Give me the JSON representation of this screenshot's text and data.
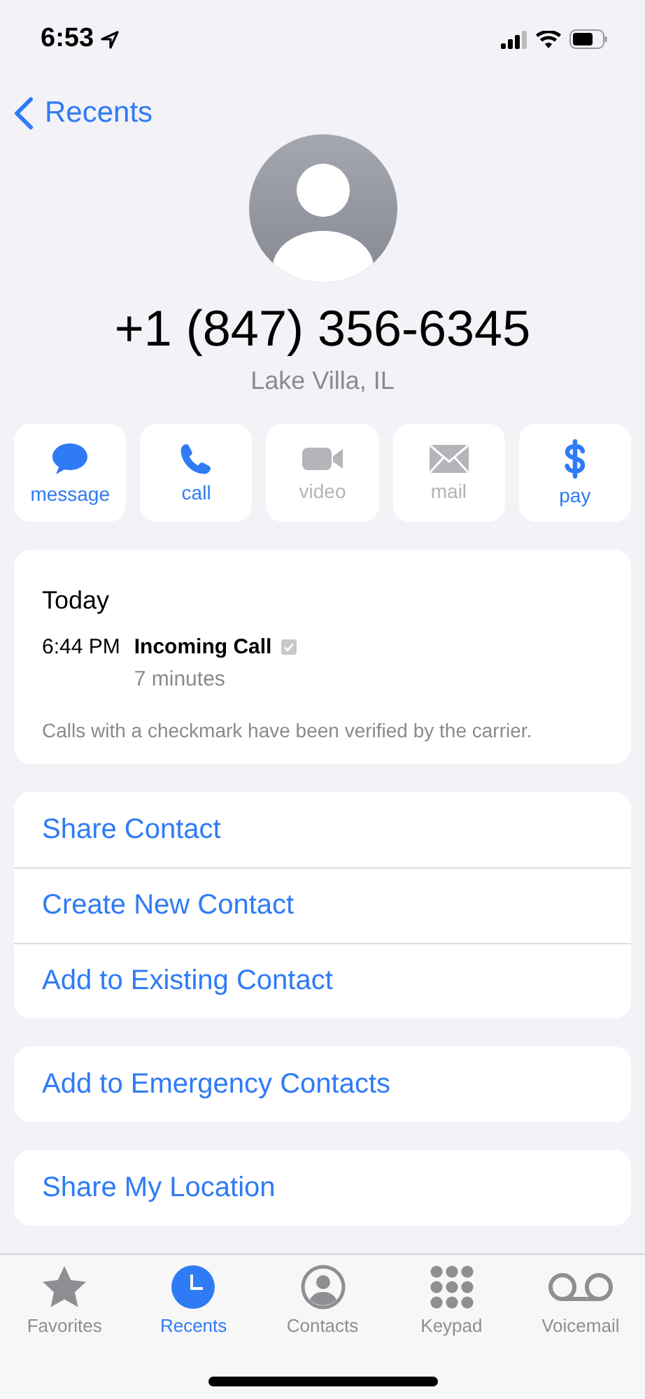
{
  "status_bar": {
    "time": "6:53"
  },
  "nav": {
    "back_label": "Recents"
  },
  "contact": {
    "number": "+1 (847) 356-6345",
    "location": "Lake Villa, IL"
  },
  "actions": [
    {
      "kind": "message",
      "label": "message",
      "disabled": false
    },
    {
      "kind": "call",
      "label": "call",
      "disabled": false
    },
    {
      "kind": "video",
      "label": "video",
      "disabled": true
    },
    {
      "kind": "mail",
      "label": "mail",
      "disabled": true
    },
    {
      "kind": "pay",
      "label": "pay",
      "disabled": false
    }
  ],
  "call_log": {
    "day": "Today",
    "entries": [
      {
        "time": "6:44 PM",
        "type": "Incoming Call",
        "verified": true,
        "duration": "7 minutes"
      }
    ],
    "note": "Calls with a checkmark have been verified by the carrier."
  },
  "option_groups": [
    [
      "Share Contact",
      "Create New Contact",
      "Add to Existing Contact"
    ],
    [
      "Add to Emergency Contacts"
    ],
    [
      "Share My Location"
    ]
  ],
  "tabs": [
    {
      "kind": "favorites",
      "label": "Favorites",
      "selected": false
    },
    {
      "kind": "recents",
      "label": "Recents",
      "selected": true
    },
    {
      "kind": "contacts",
      "label": "Contacts",
      "selected": false
    },
    {
      "kind": "keypad",
      "label": "Keypad",
      "selected": false
    },
    {
      "kind": "voicemail",
      "label": "Voicemail",
      "selected": false
    }
  ]
}
